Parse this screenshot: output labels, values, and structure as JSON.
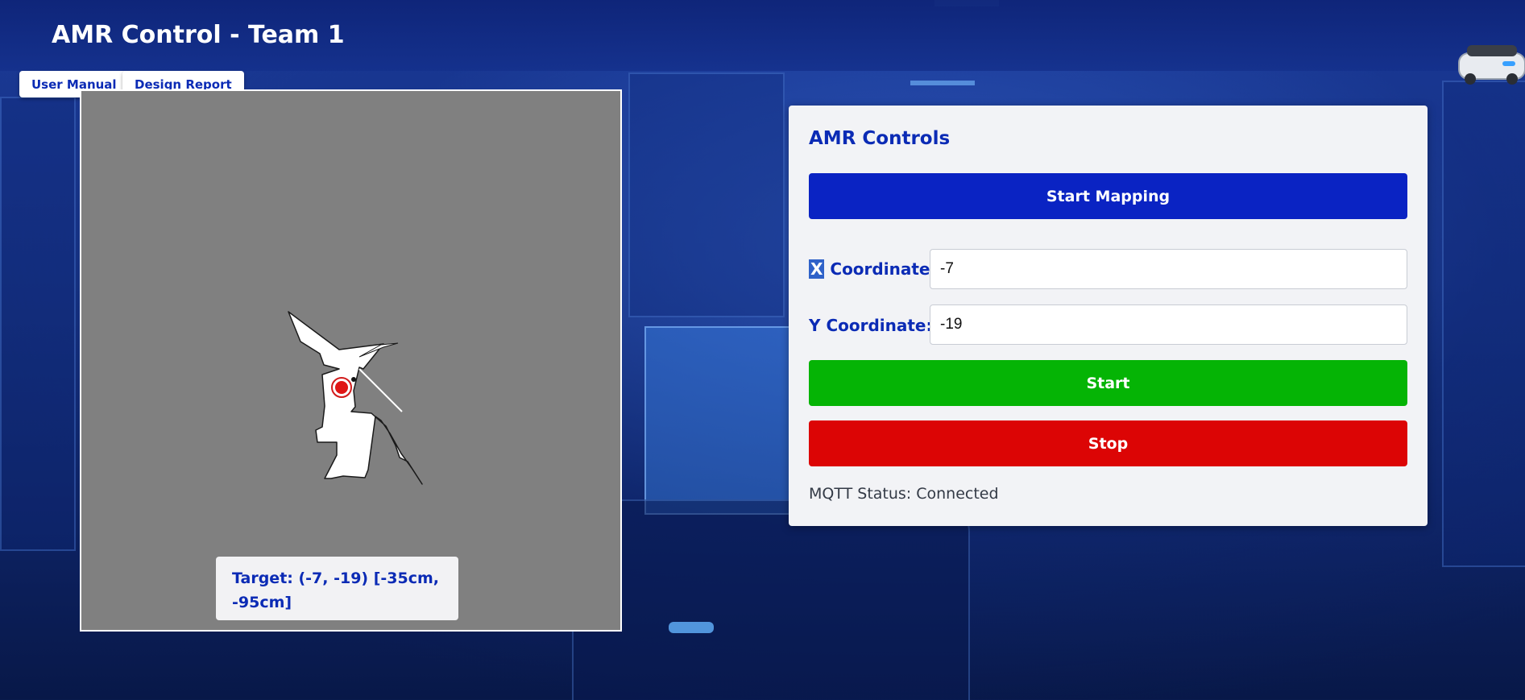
{
  "header": {
    "title": "AMR Control - Team 1"
  },
  "doc_links": [
    {
      "label": "User Manual"
    },
    {
      "label": "Design Report"
    }
  ],
  "map": {
    "target_text": "Target: (-7, -19) [-35cm, -95cm]",
    "robot_marker_icon": "red-dot-icon"
  },
  "controls": {
    "title": "AMR Controls",
    "start_mapping_label": "Start Mapping",
    "x_label_prefix": "X",
    "x_label_suffix": " Coordinate:",
    "x_value": "-7",
    "y_label": "Y Coordinate:",
    "y_value": "-19",
    "start_label": "Start",
    "stop_label": "Stop",
    "mqtt_status": "MQTT Status: Connected"
  },
  "colors": {
    "accent": "#0a23c3",
    "start": "#05b405",
    "stop": "#dc0505",
    "map_bg": "#808080"
  }
}
